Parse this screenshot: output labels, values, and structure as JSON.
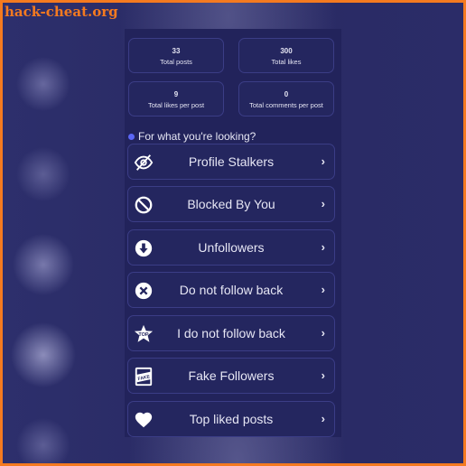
{
  "watermark": "hack-cheat.org",
  "stats": [
    {
      "value": "33",
      "label": "Total posts"
    },
    {
      "value": "300",
      "label": "Total likes"
    },
    {
      "value": "9",
      "label": "Total likes per post"
    },
    {
      "value": "0",
      "label": "Total comments per post"
    }
  ],
  "section_title": "For what you're looking?",
  "menu": [
    {
      "label": "Profile Stalkers",
      "icon": "eye-slash-icon"
    },
    {
      "label": "Blocked By You",
      "icon": "blocked-icon"
    },
    {
      "label": "Unfollowers",
      "icon": "arrow-down-circle-icon"
    },
    {
      "label": "Do not follow back",
      "icon": "x-circle-icon"
    },
    {
      "label": "I do not follow back",
      "icon": "top-star-icon"
    },
    {
      "label": "Fake Followers",
      "icon": "fake-stamp-icon"
    },
    {
      "label": "Top liked posts",
      "icon": "heart-icon"
    }
  ],
  "chevron": "›",
  "colors": {
    "accent": "#5b66f5",
    "frame": "#f47a20",
    "panel": "#22235b"
  }
}
